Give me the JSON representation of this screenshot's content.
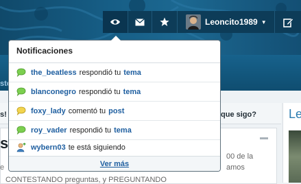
{
  "topbar": {
    "icons": [
      "eye-icon",
      "mail-icon",
      "star-icon",
      "edit-icon"
    ],
    "username": "Leoncito1989",
    "accent": "#0d3c58"
  },
  "popup": {
    "title": "Notificaciones",
    "notifications": [
      {
        "icon": "speech-bubble-green-icon",
        "user": "the_beatless",
        "verb": "respondió tu",
        "object": "tema"
      },
      {
        "icon": "speech-bubble-green-icon",
        "user": "blanconegro",
        "verb": "respondió tu",
        "object": "tema"
      },
      {
        "icon": "speech-bubble-yellow-icon",
        "user": "foxy_lady",
        "verb": "comentó tu",
        "object": "post"
      },
      {
        "icon": "speech-bubble-green-icon",
        "user": "roy_vader",
        "verb": "respondió tu",
        "object": "tema"
      },
      {
        "icon": "user-add-icon",
        "user": "wybern03",
        "verb": "te está siguiendo",
        "object": ""
      }
    ],
    "more_label": "Ver más",
    "link_color": "#1f5fa0"
  },
  "background": {
    "nav_fragment": "sto",
    "question_left": "s! ¿",
    "question_right": "que sigo?",
    "heading_fragment": "st",
    "side_heading": "Le",
    "text_1": "00 de la",
    "text_2": "amos",
    "text_3": "CONTESTANDO preguntas, y PREGUNTANDO",
    "text_left": "e"
  }
}
